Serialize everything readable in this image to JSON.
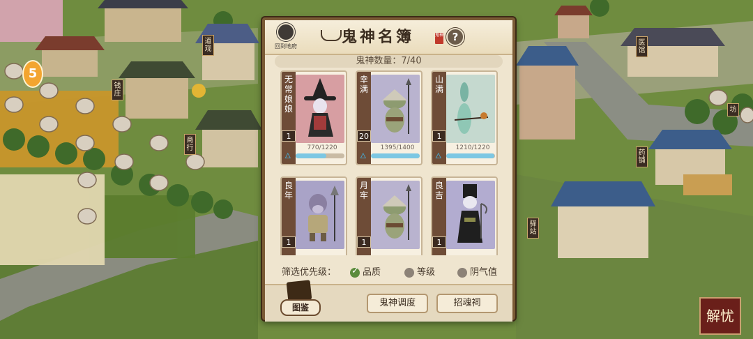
{
  "header": {
    "title": "鬼神名簿",
    "back_label": "回到地府",
    "help_label": "?",
    "seal_text": "鬼神"
  },
  "summary": {
    "count_label": "鬼神数量：",
    "count_value": "7/40"
  },
  "cards": [
    {
      "name": "无常娘娘",
      "level": "1",
      "stat": "770/1220",
      "fill_fraction": 0.63,
      "portrait_bg": "#d79ea2",
      "figure": "witch-icon"
    },
    {
      "name": "幸满",
      "level": "20",
      "stat": "1395/1400",
      "fill_fraction": 0.996,
      "portrait_bg": "#b9b3cf",
      "figure": "ghost-soldier-icon"
    },
    {
      "name": "山满",
      "level": "1",
      "stat": "1210/1220",
      "fill_fraction": 0.99,
      "portrait_bg": "#c5d9cf",
      "figure": "mountain-spirit-icon"
    },
    {
      "name": "良年",
      "level": "1",
      "stat": "",
      "fill_fraction": 0,
      "portrait_bg": "#a9a3c7",
      "figure": "horse-face-icon"
    },
    {
      "name": "月牢",
      "level": "1",
      "stat": "",
      "fill_fraction": 0,
      "portrait_bg": "#b9b3cf",
      "figure": "ghost-soldier-icon"
    },
    {
      "name": "良吉",
      "level": "1",
      "stat": "",
      "fill_fraction": 0,
      "portrait_bg": "#b2acd0",
      "figure": "tall-hat-ghost-icon"
    }
  ],
  "filter": {
    "label": "筛选优先级：",
    "options": [
      {
        "label": "品质",
        "selected": true
      },
      {
        "label": "等级",
        "selected": false
      },
      {
        "label": "阴气值",
        "selected": false
      }
    ]
  },
  "buttons": {
    "tujian": "图鉴",
    "dispatch": "鬼神调度",
    "summon": "招魂祠"
  },
  "side": {
    "coin_label": "5",
    "corner_label": "解忧"
  },
  "signs": [
    "钱庄",
    "道观",
    "商行",
    "医馆",
    "药铺",
    "驿站",
    "坊"
  ],
  "colors": {
    "panel_bg": "#efe5cf",
    "panel_border": "#7a5a35",
    "name_strip": "#6e4c37",
    "bar_fill": "#7cc7e3",
    "selected_radio": "#5b8b3c"
  }
}
